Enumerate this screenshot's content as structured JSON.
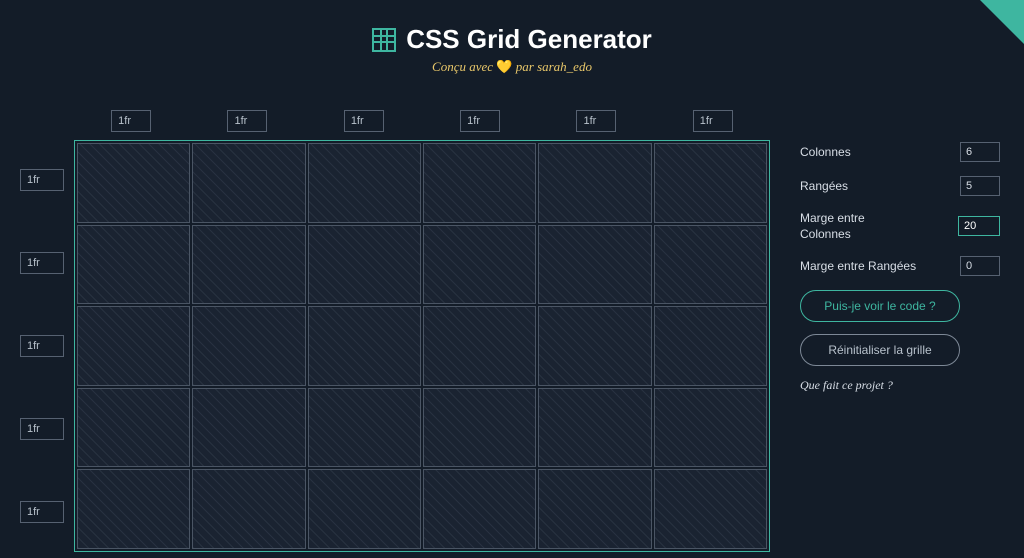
{
  "header": {
    "title": "CSS Grid Generator",
    "subtitle_prefix": "Conçu avec ",
    "subtitle_heart": "💛",
    "subtitle_by": " par ",
    "subtitle_author": "sarah_edo"
  },
  "grid": {
    "columns": 6,
    "rows": 5,
    "col_units": [
      "1fr",
      "1fr",
      "1fr",
      "1fr",
      "1fr",
      "1fr"
    ],
    "row_units": [
      "1fr",
      "1fr",
      "1fr",
      "1fr",
      "1fr"
    ]
  },
  "sidebar": {
    "columns_label": "Colonnes",
    "columns_value": "6",
    "rows_label": "Rangées",
    "rows_value": "5",
    "col_gap_label_line1": "Marge entre",
    "col_gap_label_line2": "Colonnes",
    "col_gap_value": "20",
    "row_gap_label": "Marge entre Rangées",
    "row_gap_value": "0",
    "show_code_btn": "Puis-je voir le code ?",
    "reset_btn": "Réinitialiser la grille",
    "about_link": "Que fait ce projet ?"
  },
  "colors": {
    "accent": "#3eb6a0",
    "bg": "#131c28"
  }
}
